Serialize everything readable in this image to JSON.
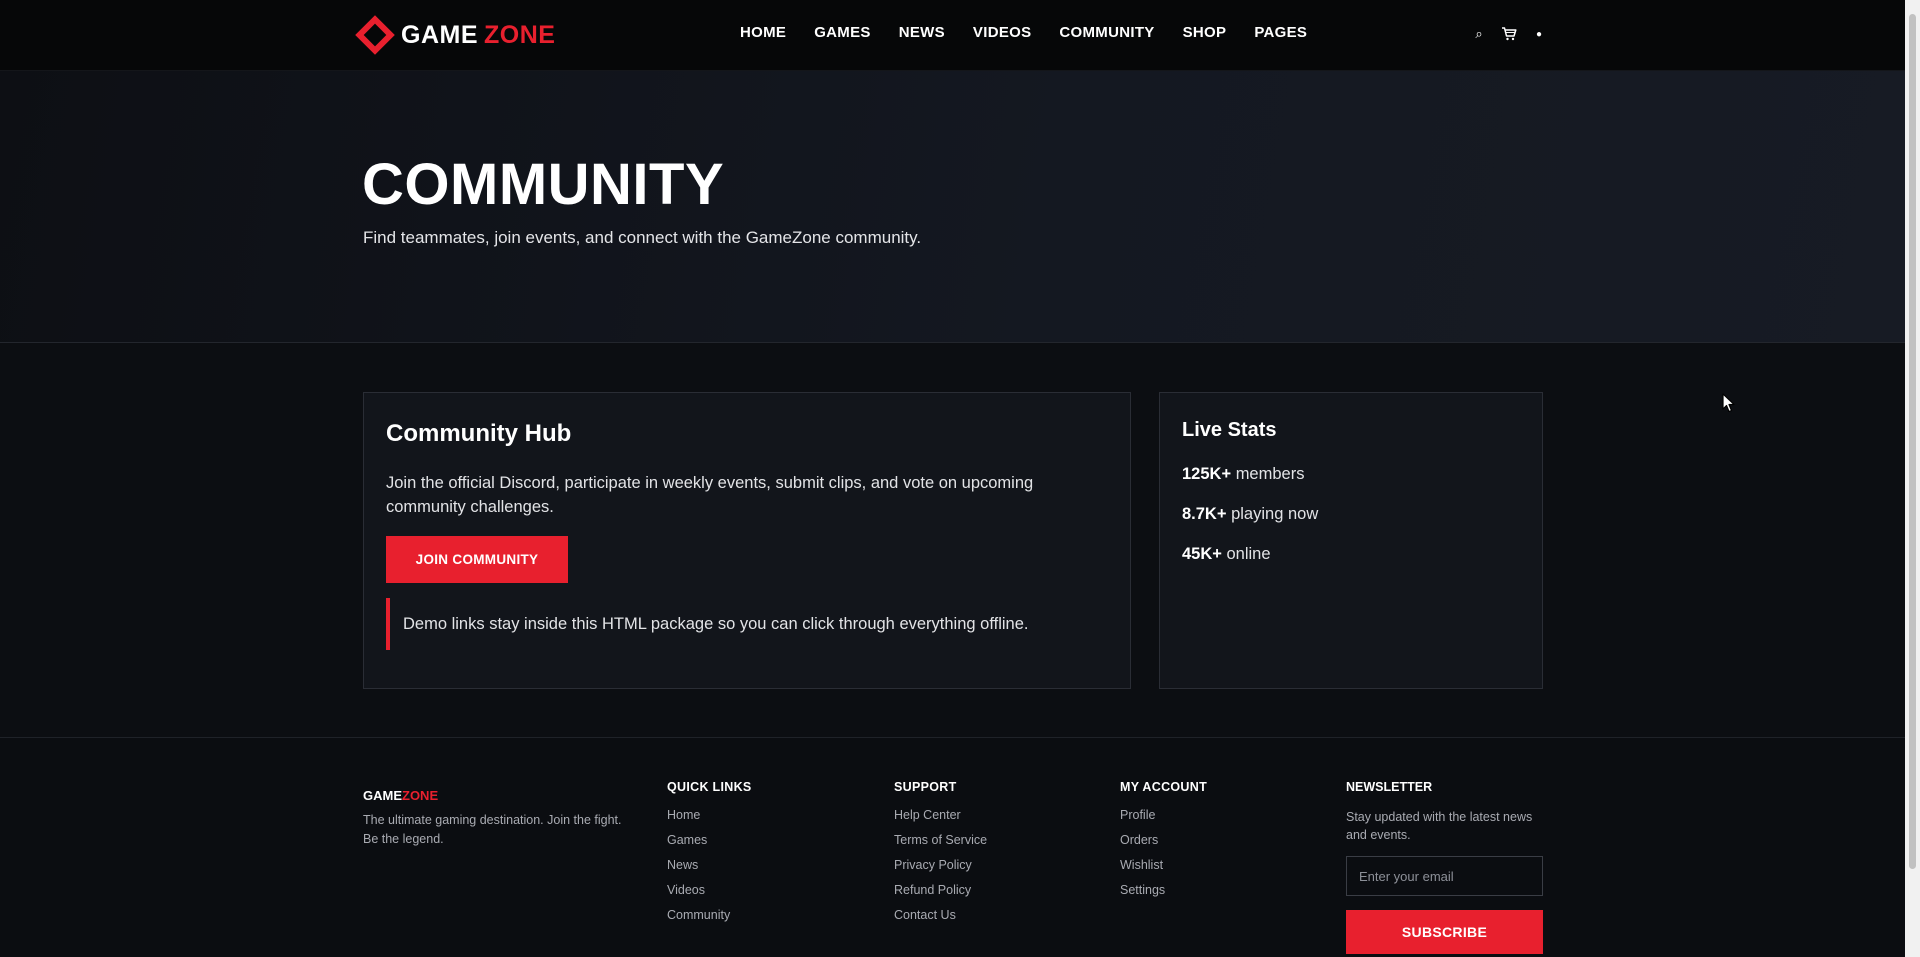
{
  "brand": {
    "name_part1": "GAME",
    "name_part2": "ZONE",
    "accent_color": "#e8202e"
  },
  "nav": {
    "items": [
      {
        "label": "HOME"
      },
      {
        "label": "GAMES"
      },
      {
        "label": "NEWS"
      },
      {
        "label": "VIDEOS"
      },
      {
        "label": "COMMUNITY"
      },
      {
        "label": "SHOP"
      },
      {
        "label": "PAGES"
      }
    ],
    "tools": {
      "search_icon": "⌕",
      "profile_icon": "●"
    }
  },
  "hero": {
    "title": "COMMUNITY",
    "subtitle": "Find teammates, join events, and connect with the GameZone community."
  },
  "hub": {
    "title": "Community Hub",
    "description": "Join the official Discord, participate in weekly events, submit clips, and vote on upcoming community challenges.",
    "button_label": "JOIN COMMUNITY",
    "note": "Demo links stay inside this HTML package so you can click through everything offline."
  },
  "stats": {
    "title": "Live Stats",
    "items": [
      {
        "value": "125K+",
        "label": "members"
      },
      {
        "value": "8.7K+",
        "label": "playing now"
      },
      {
        "value": "45K+",
        "label": "online"
      }
    ]
  },
  "footer": {
    "brand_part1": "GAME",
    "brand_part2": "ZONE",
    "about": "The ultimate gaming destination. Join the fight. Be the legend.",
    "quick_links": {
      "title": "QUICK LINKS",
      "links": [
        "Home",
        "Games",
        "News",
        "Videos",
        "Community"
      ]
    },
    "support": {
      "title": "SUPPORT",
      "links": [
        "Help Center",
        "Terms of Service",
        "Privacy Policy",
        "Refund Policy",
        "Contact Us"
      ]
    },
    "account": {
      "title": "MY ACCOUNT",
      "links": [
        "Profile",
        "Orders",
        "Wishlist",
        "Settings"
      ]
    },
    "newsletter": {
      "title": "NEWSLETTER",
      "text": "Stay updated with the latest news and events.",
      "placeholder": "Enter your email",
      "button_label": "SUBSCRIBE"
    }
  }
}
